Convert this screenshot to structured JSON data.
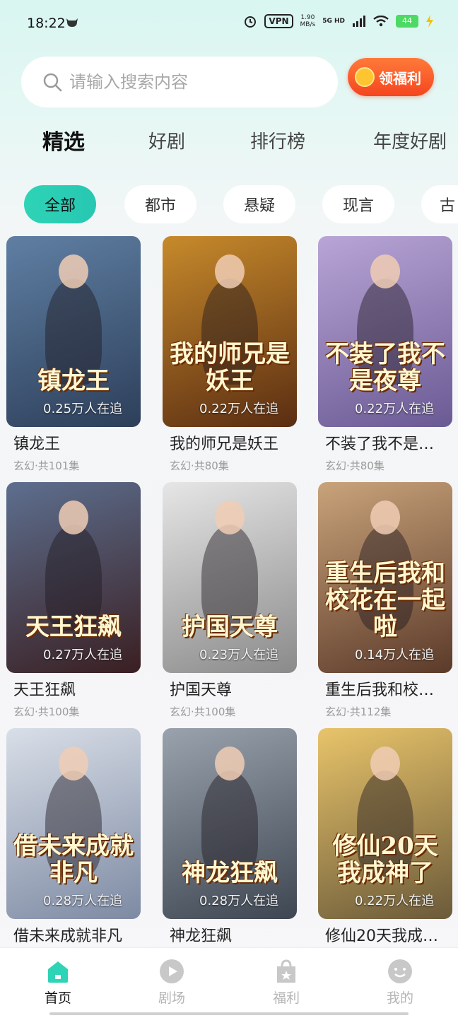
{
  "status_bar": {
    "time": "18:22",
    "vpn": "VPN",
    "speed_value": "1.90",
    "speed_unit": "MB/s",
    "network": "5G HD",
    "battery": "44"
  },
  "search": {
    "placeholder": "请输入搜索内容"
  },
  "bonus_button": {
    "label": "领福利"
  },
  "main_tabs": [
    {
      "label": "精选",
      "active": true
    },
    {
      "label": "好剧",
      "active": false
    },
    {
      "label": "排行榜",
      "active": false
    },
    {
      "label": "年度好剧",
      "active": false
    }
  ],
  "categories": [
    {
      "label": "全部",
      "active": true
    },
    {
      "label": "都市",
      "active": false
    },
    {
      "label": "悬疑",
      "active": false
    },
    {
      "label": "现言",
      "active": false
    },
    {
      "label": "古",
      "active": false
    }
  ],
  "dramas": [
    {
      "title": "镇龙王",
      "poster_text": "镇龙王",
      "followers": "0.25万人在追",
      "meta": "玄幻·共101集",
      "colors": [
        "#5f7fa3",
        "#2d3f5a"
      ]
    },
    {
      "title": "我的师兄是妖王",
      "poster_text": "我的师兄是妖王",
      "followers": "0.22万人在追",
      "meta": "玄幻·共80集",
      "colors": [
        "#c78a2b",
        "#5a2d12"
      ]
    },
    {
      "title": "不装了我不是…",
      "poster_text": "不装了我不是夜尊",
      "followers": "0.22万人在追",
      "meta": "玄幻·共80集",
      "colors": [
        "#b9a5d6",
        "#6a5a94"
      ]
    },
    {
      "title": "天王狂飙",
      "poster_text": "天王狂飙",
      "followers": "0.27万人在追",
      "meta": "玄幻·共100集",
      "colors": [
        "#5d6f8f",
        "#3a1f22"
      ]
    },
    {
      "title": "护国天尊",
      "poster_text": "护国天尊",
      "followers": "0.23万人在追",
      "meta": "玄幻·共100集",
      "colors": [
        "#e6e6e6",
        "#8a8a8a"
      ]
    },
    {
      "title": "重生后我和校…",
      "poster_text": "重生后我和校花在一起啦",
      "followers": "0.14万人在追",
      "meta": "玄幻·共112集",
      "colors": [
        "#c9a37a",
        "#5b3a2a"
      ]
    },
    {
      "title": "借未来成就非凡",
      "poster_text": "借未来成就非凡",
      "followers": "0.28万人在追",
      "meta": "",
      "colors": [
        "#d9dfe8",
        "#7d8aa3"
      ]
    },
    {
      "title": "神龙狂飙",
      "poster_text": "神龙狂飙",
      "followers": "0.28万人在追",
      "meta": "",
      "colors": [
        "#9aa3ad",
        "#3e4652"
      ]
    },
    {
      "title": "修仙20天我成…",
      "poster_text": "修仙20天我成神了",
      "followers": "0.22万人在追",
      "meta": "",
      "colors": [
        "#e8c46a",
        "#6b5a3a"
      ]
    }
  ],
  "bottom_nav": [
    {
      "label": "首页",
      "icon": "home-icon",
      "active": true
    },
    {
      "label": "剧场",
      "icon": "play-icon",
      "active": false
    },
    {
      "label": "福利",
      "icon": "gift-bag-icon",
      "active": false
    },
    {
      "label": "我的",
      "icon": "profile-face-icon",
      "active": false
    }
  ],
  "colors": {
    "accent": "#2ed4b6",
    "bonus": "#f5451f"
  }
}
